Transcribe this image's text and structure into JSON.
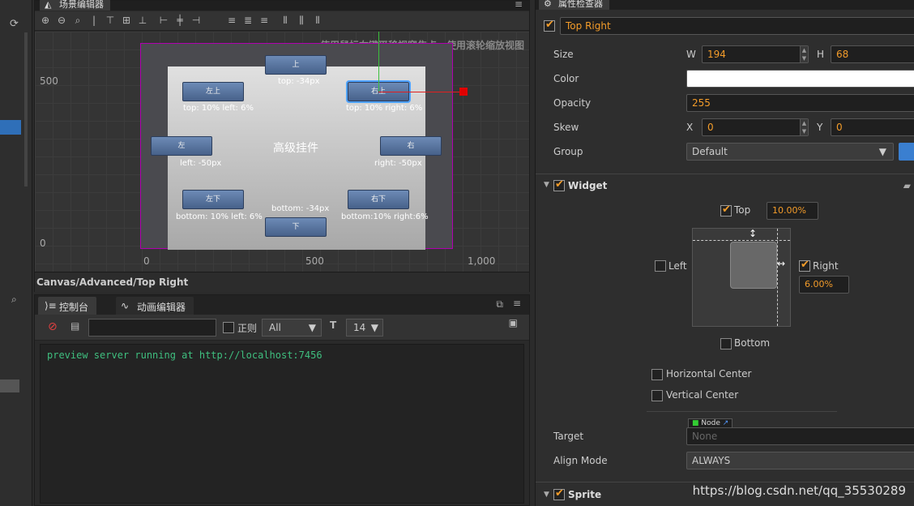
{
  "scene_editor": {
    "tab_title": "场景编辑器",
    "hint": "使用鼠标右键平移视窗焦点，使用滚轮缩放视图",
    "axis": {
      "y_500": "500",
      "y_0": "0",
      "x_0": "0",
      "x_500": "500",
      "x_1000": "1,000"
    },
    "panel_title": "高级挂件",
    "buttons": {
      "top": "上",
      "top_left": "左上",
      "top_right": "右上",
      "left": "左",
      "right": "右",
      "bottom_left": "左下",
      "bottom_right": "右下",
      "bottom": "下"
    },
    "labels": {
      "top": "top: -34px",
      "top_left": "top: 10% left: 6%",
      "top_right": "top: 10% right: 6%",
      "left": "left: -50px",
      "right": "right: -50px",
      "bottom_left": "bottom: 10% left: 6%",
      "bottom": "bottom: -34px",
      "bottom_right": "bottom:10% right:6%"
    },
    "breadcrumb": "Canvas/Advanced/Top Right"
  },
  "console": {
    "tab_console": "控制台",
    "tab_animation": "动画编辑器",
    "regex_label": "正则",
    "level_select": "All",
    "font_size": "14",
    "output_line": "preview server running at http://localhost:7456"
  },
  "inspector": {
    "tab_title": "属性检查器",
    "node_name": "Top Right",
    "size_label": "Size",
    "w_label": "W",
    "w_value": "194",
    "h_label": "H",
    "h_value": "68",
    "color_label": "Color",
    "opacity_label": "Opacity",
    "opacity_value": "255",
    "skew_label": "Skew",
    "skew_x_label": "X",
    "skew_x": "0",
    "skew_y_label": "Y",
    "skew_y": "0",
    "group_label": "Group",
    "group_value": "Default",
    "widget_title": "Widget",
    "top_label": "Top",
    "top_value": "10.00%",
    "left_label": "Left",
    "right_label": "Right",
    "right_value": "6.00%",
    "bottom_label": "Bottom",
    "hcenter_label": "Horizontal Center",
    "vcenter_label": "Vertical Center",
    "target_label": "Target",
    "node_tag": "Node",
    "target_value": "None",
    "align_mode_label": "Align Mode",
    "align_mode_value": "ALWAYS",
    "sprite_title": "Sprite"
  },
  "watermark": "https://blog.csdn.net/qq_35530289"
}
